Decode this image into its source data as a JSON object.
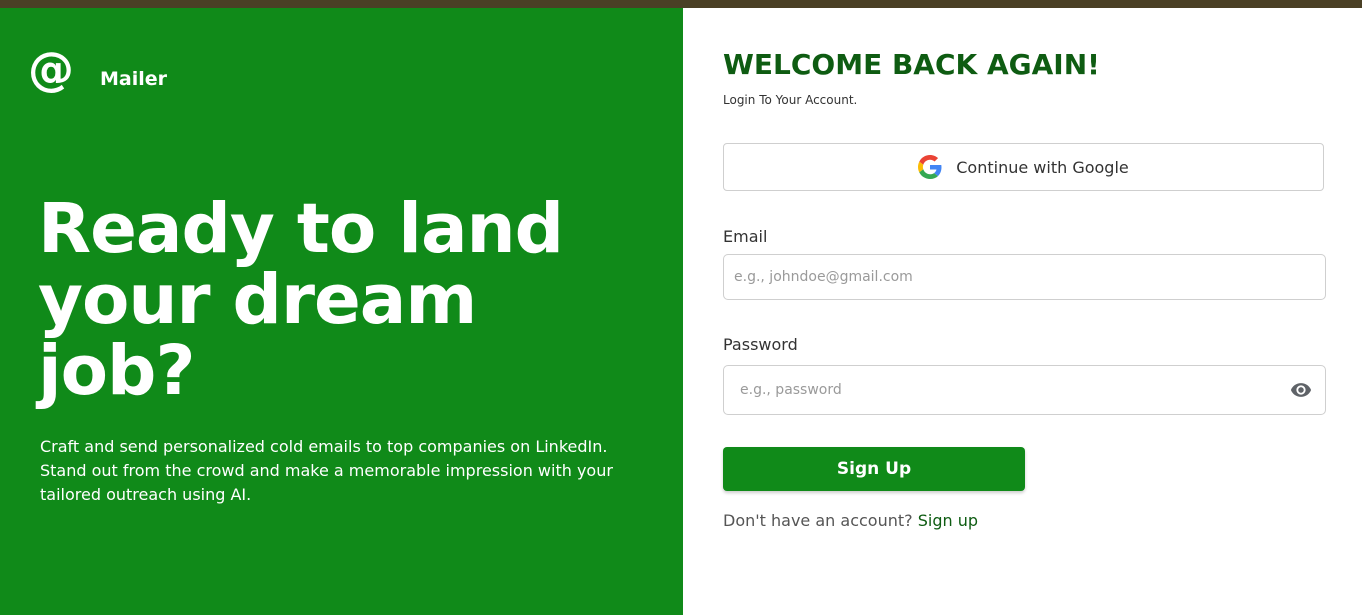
{
  "brand": {
    "name": "Mailer",
    "logo_glyph": "@"
  },
  "hero": {
    "headline_lines": [
      "Ready to land",
      "your dream",
      "job?"
    ],
    "description": "Craft and send personalized cold emails to top companies on LinkedIn. Stand out from the crowd and make a memorable impression with your tailored outreach using AI."
  },
  "login": {
    "title": "WELCOME BACK AGAIN!",
    "subtitle": "Login To Your Account.",
    "google_button_label": "Continue with Google",
    "email_label": "Email",
    "email_placeholder": "e.g., johndoe@gmail.com",
    "password_label": "Password",
    "password_placeholder": "e.g., password",
    "submit_label": "Sign Up",
    "footer_text": "Don't have an account?",
    "footer_link": "Sign up"
  },
  "icons": {
    "logo": "at-sign-icon",
    "google": "google-icon",
    "password_toggle": "eye-icon"
  },
  "colors": {
    "brand_green": "#108a19",
    "title_green": "#0e5c12",
    "top_bar": "#4a4025"
  }
}
